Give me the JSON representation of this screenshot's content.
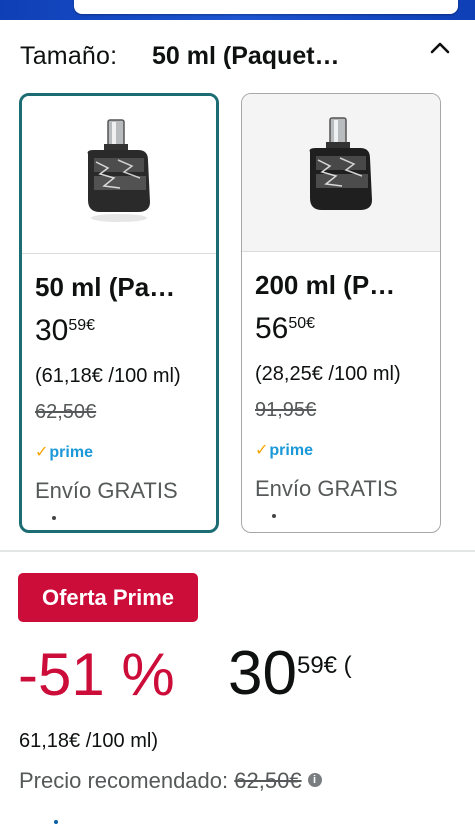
{
  "size_selector": {
    "label": "Tamaño:",
    "selected": "50 ml (Paquet…"
  },
  "options": [
    {
      "title": "50 ml (Pa…",
      "price_whole": "30",
      "price_fraction": "59€",
      "unit_price": "(61,18€ /100 ml)",
      "list_price": "62,50€",
      "prime": "prime",
      "shipping": "Envío GRATIS",
      "selected": true,
      "image_icon": "perfume-bottle-icon"
    },
    {
      "title": "200 ml (P…",
      "price_whole": "56",
      "price_fraction": "50€",
      "unit_price": "(28,25€ /100 ml)",
      "list_price": "91,95€",
      "prime": "prime",
      "shipping": "Envío GRATIS",
      "selected": false,
      "image_icon": "perfume-bottle-icon"
    }
  ],
  "deal": {
    "badge": "Oferta Prime",
    "discount": "-51 %",
    "price_whole": "30",
    "price_fraction": "59€ (",
    "unit_price": "61,18€ /100 ml)",
    "recommended_label": "Precio recomendado:",
    "recommended_price": "62,50€"
  },
  "colors": {
    "deal_red": "#cc0c39",
    "selected_border": "#1b6d73",
    "prime_blue": "#1a98d7",
    "header_blue": "#1d55d2"
  }
}
